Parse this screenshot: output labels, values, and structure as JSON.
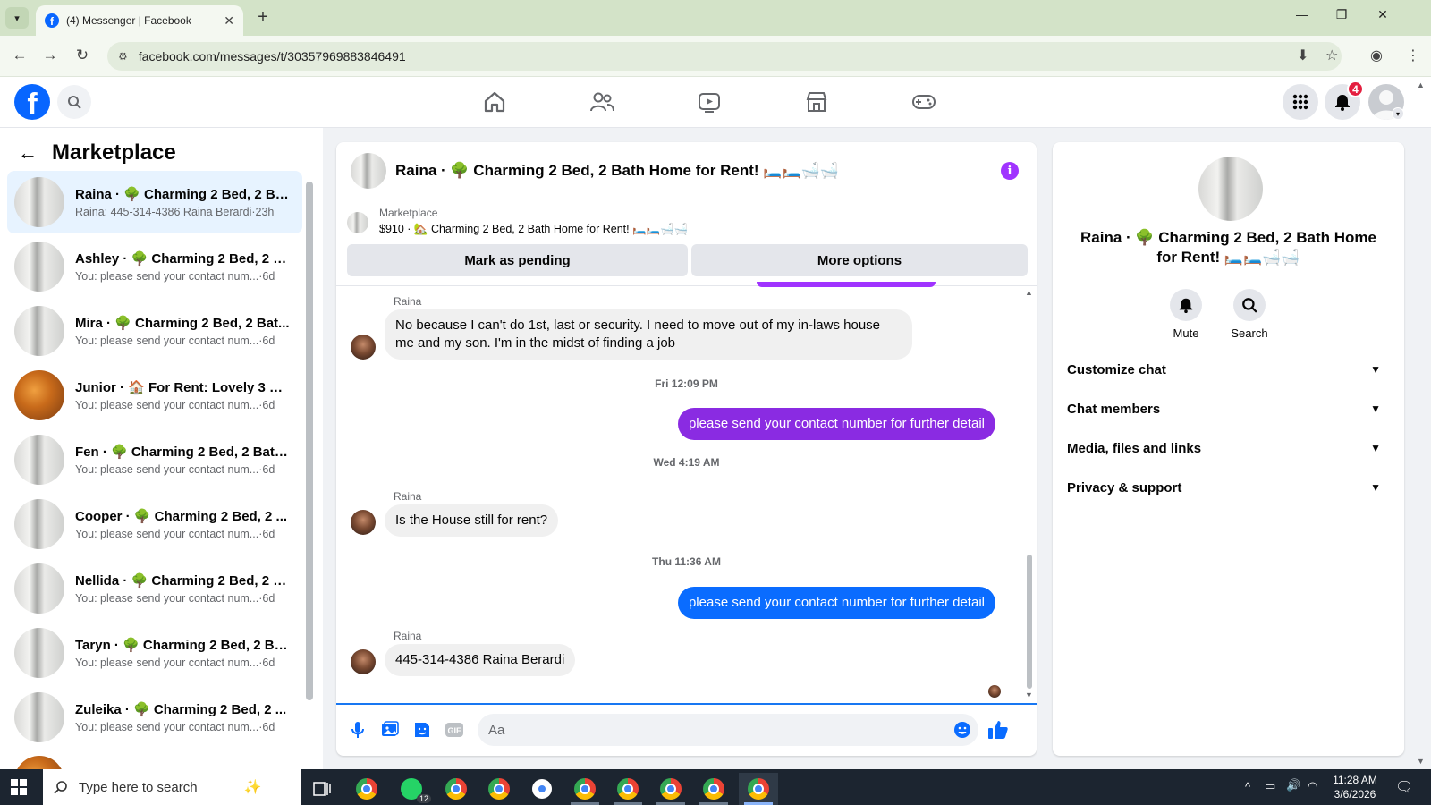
{
  "browser": {
    "tab_title": "(4) Messenger | Facebook",
    "url": "facebook.com/messages/t/30357969883846491"
  },
  "header": {
    "notification_count": "4"
  },
  "sidebar": {
    "title": "Marketplace",
    "conversations": [
      {
        "name": "Raina · 🌳 Charming 2 Bed, 2 Ba...",
        "snippet": "Raina: 445-314-4386 Raina Berardi",
        "time": "·23h",
        "active": true
      },
      {
        "name": "Ashley · 🌳 Charming 2 Bed, 2 B...",
        "snippet": "You: please send your contact num...",
        "time": "·6d"
      },
      {
        "name": "Mira · 🌳 Charming 2 Bed, 2 Bat...",
        "snippet": "You: please send your contact num...",
        "time": "·6d"
      },
      {
        "name": "Junior · 🏠 For Rent: Lovely 3 Be...",
        "snippet": "You: please send your contact num...",
        "time": "·6d"
      },
      {
        "name": "Fen · 🌳 Charming 2 Bed, 2 Bath...",
        "snippet": "You: please send your contact num...",
        "time": "·6d"
      },
      {
        "name": "Cooper · 🌳 Charming 2 Bed, 2 ...",
        "snippet": "You: please send your contact num...",
        "time": "·6d"
      },
      {
        "name": "Nellida · 🌳 Charming 2 Bed, 2 B...",
        "snippet": "You: please send your contact num...",
        "time": "·6d"
      },
      {
        "name": "Taryn · 🌳 Charming 2 Bed, 2 Ba...",
        "snippet": "You: please send your contact num...",
        "time": "·6d"
      },
      {
        "name": "Zuleika · 🌳 Charming 2 Bed, 2 ...",
        "snippet": "You: please send your contact num...",
        "time": "·6d"
      }
    ]
  },
  "chat": {
    "title": "Raina · 🌳 Charming 2 Bed, 2 Bath Home for Rent! 🛏️🛏️🛁🛁",
    "marketplace_label": "Marketplace",
    "listing": "$910 · 🏡 Charming 2 Bed, 2 Bath Home for Rent! 🛏️🛏️🛁🛁",
    "mark_pending": "Mark as pending",
    "more_options": "More options",
    "messages": {
      "m1_sender": "Raina",
      "m1_text": "No because I can't do 1st, last or security. I need to move out of my in-laws house me and my son. I'm in the midst of finding a job",
      "ts1": "Fri 12:09 PM",
      "m2_text": "please send your contact number for further detail",
      "ts2": "Wed 4:19 AM",
      "m3_sender": "Raina",
      "m3_text": "Is the House still for rent?",
      "ts3": "Thu 11:36 AM",
      "m4_text": "please send your contact number for further detail",
      "m5_sender": "Raina",
      "m5_text": "445-314-4386 Raina Berardi"
    },
    "composer_placeholder": "Aa"
  },
  "right_panel": {
    "name": "Raina · 🌳 Charming 2 Bed, 2 Bath Home for Rent! 🛏️🛏️🛁🛁",
    "mute_label": "Mute",
    "search_label": "Search",
    "sections": [
      "Customize chat",
      "Chat members",
      "Media, files and links",
      "Privacy & support"
    ]
  },
  "taskbar": {
    "search_placeholder": "Type here to search",
    "whatsapp_badge": "12",
    "time": "11:28 AM",
    "date": "3/6/2026"
  },
  "colors": {
    "fb_blue": "#0866ff",
    "purple_bubble": "#8a2be2",
    "blue_bubble": "#0a6cff",
    "accent_purple": "#a033ff"
  }
}
